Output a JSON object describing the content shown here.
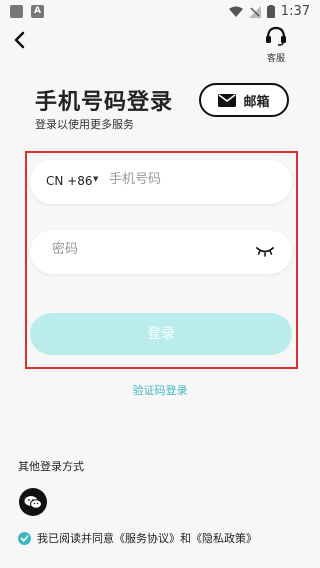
{
  "status_bar": {
    "time": "1:37",
    "notif_letter": "A"
  },
  "header": {
    "customer_service_label": "客服"
  },
  "title": "手机号码登录",
  "subtitle": "登录以使用更多服务",
  "email_button": {
    "label": "邮箱",
    "icon": "mail-icon"
  },
  "phone_field": {
    "country_code": "CN +86",
    "placeholder": "手机号码",
    "value": ""
  },
  "password_field": {
    "placeholder": "密码",
    "value": ""
  },
  "login_button": {
    "label": "登录"
  },
  "verification_link": "验证码登录",
  "other_methods": {
    "label": "其他登录方式",
    "icon": "wechat-icon"
  },
  "agreement": {
    "text": "我已阅读并同意《服务协议》和《隐私政策》",
    "checked": true
  },
  "colors": {
    "accent": "#3db9c6",
    "login_disabled": "#b9ecea",
    "highlight": "#d9312b"
  }
}
